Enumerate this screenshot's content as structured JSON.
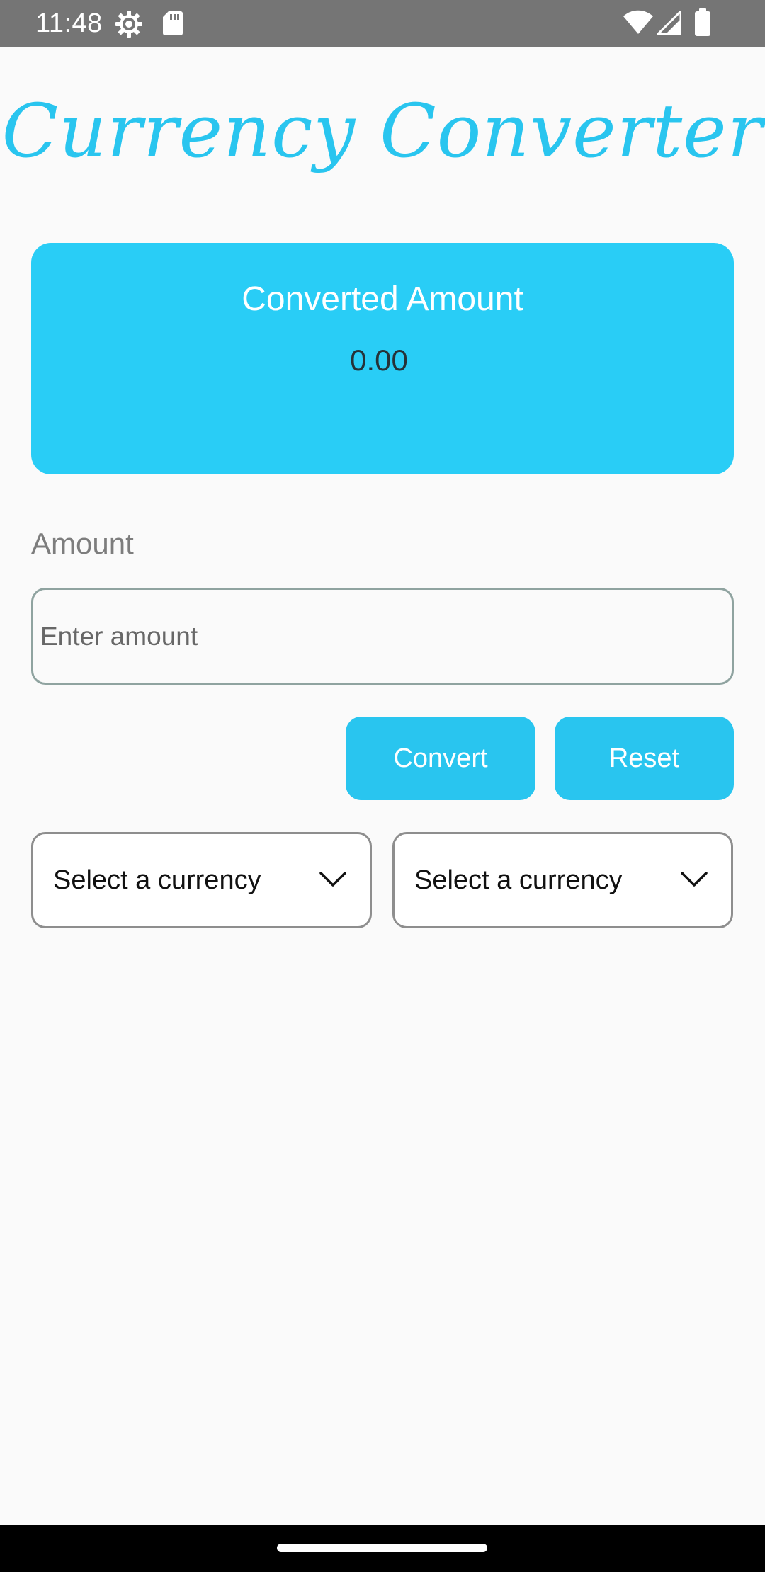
{
  "status_bar": {
    "time": "11:48",
    "icons": [
      "settings-icon",
      "sd-card-icon",
      "wifi-icon",
      "signal-icon",
      "battery-icon"
    ]
  },
  "app": {
    "title": "Currency Converter",
    "accent_color": "#29c5ef",
    "card_color": "#29cdf6"
  },
  "result": {
    "label": "Converted Amount",
    "value": "0.00"
  },
  "amount": {
    "label": "Amount",
    "placeholder": "Enter amount",
    "value": ""
  },
  "buttons": {
    "convert": "Convert",
    "reset": "Reset"
  },
  "currency_selects": [
    {
      "selected": "Select a currency",
      "icon": "chevron-down-icon"
    },
    {
      "selected": "Select a currency",
      "icon": "chevron-down-icon"
    }
  ]
}
